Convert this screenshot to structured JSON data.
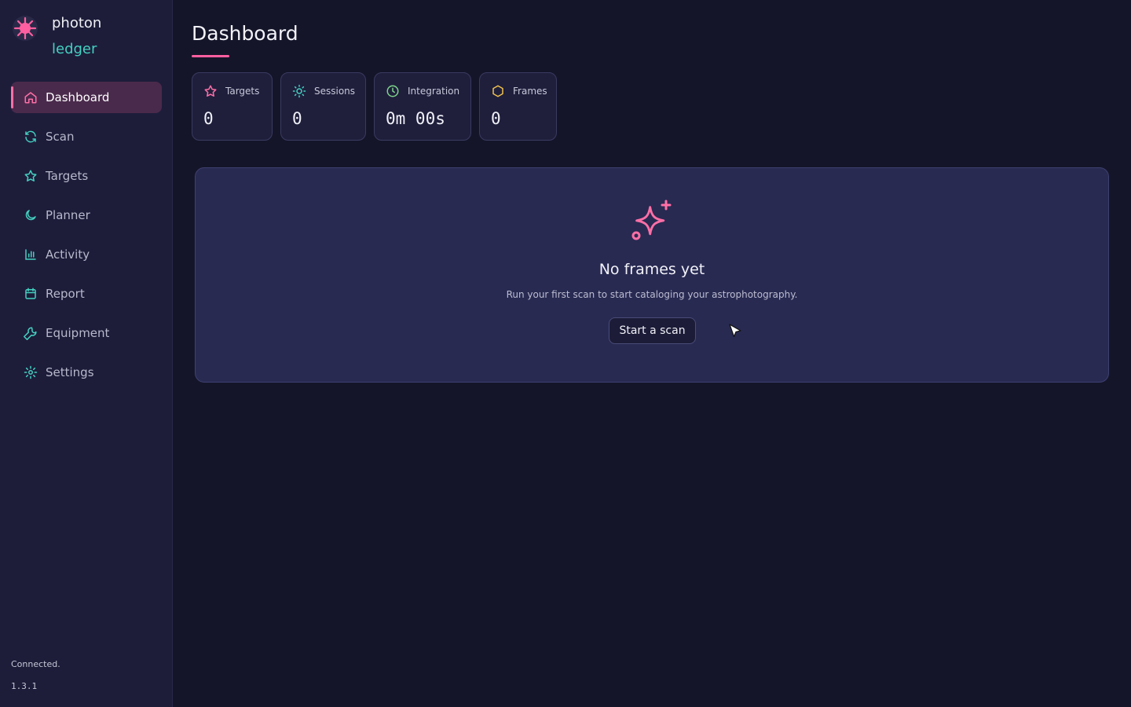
{
  "brand": {
    "name_line1": "photon",
    "name_line2": "ledger",
    "logo_icon": "star-burst-icon"
  },
  "sidebar": {
    "items": [
      {
        "label": "Dashboard",
        "icon": "home-icon",
        "active": true
      },
      {
        "label": "Scan",
        "icon": "refresh-icon"
      },
      {
        "label": "Targets",
        "icon": "star-icon"
      },
      {
        "label": "Planner",
        "icon": "moon-icon"
      },
      {
        "label": "Activity",
        "icon": "bar-chart-icon"
      },
      {
        "label": "Report",
        "icon": "calendar-icon"
      },
      {
        "label": "Equipment",
        "icon": "wrench-icon"
      },
      {
        "label": "Settings",
        "icon": "gear-icon"
      }
    ],
    "status": "Connected.",
    "version": "1.3.1"
  },
  "main": {
    "title": "Dashboard",
    "stats": [
      {
        "label": "Targets",
        "value": "0",
        "icon": "star-icon",
        "color": "#ff6fa6"
      },
      {
        "label": "Sessions",
        "value": "0",
        "icon": "sun-icon",
        "color": "#45d0c0"
      },
      {
        "label": "Integration",
        "value": "0m 00s",
        "icon": "clock-icon",
        "color": "#7ed38a"
      },
      {
        "label": "Frames",
        "value": "0",
        "icon": "hexagon-icon",
        "color": "#f2c14e"
      }
    ],
    "empty_state": {
      "icon": "sparkles-icon",
      "title": "No frames yet",
      "subtitle": "Run your first scan to start cataloging your astrophotography.",
      "button_label": "Start a scan"
    }
  },
  "colors": {
    "accent_pink": "#ff5fa0",
    "accent_teal": "#45d0c0",
    "background": "#15152a",
    "sidebar": "#1d1d3a",
    "card": "#282a52"
  }
}
